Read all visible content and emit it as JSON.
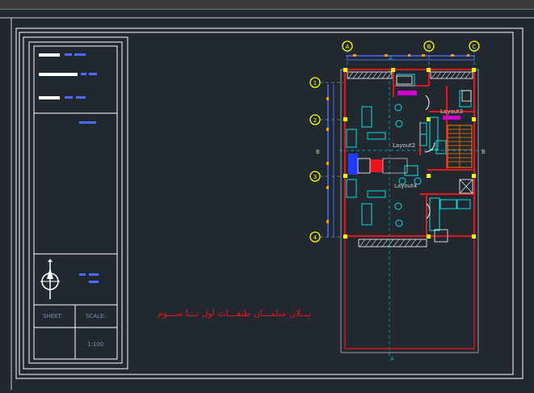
{
  "titleblock": {
    "sheet_label": "SHEET:",
    "scale_label": "SCALE:",
    "scale_value": "1:100"
  },
  "plan": {
    "grid_top": [
      "A",
      "B",
      "C"
    ],
    "grid_left": [
      "1",
      "2",
      "3",
      "4"
    ],
    "section_marks": [
      "B",
      "B",
      "A",
      "A"
    ],
    "layout_labels": [
      "Layout3",
      "Layout2",
      "Layout4"
    ],
    "caption": "پـــلان مبلمـــان طبقـــات اول تـــا ســـوم"
  },
  "colors": {
    "background": "#212830",
    "frame": "#ffffff",
    "walls": "#e8141e",
    "axes": "#ffff00",
    "furniture": "#00e5e5",
    "dims": "#4a6cff",
    "caption": "#e8141e"
  }
}
